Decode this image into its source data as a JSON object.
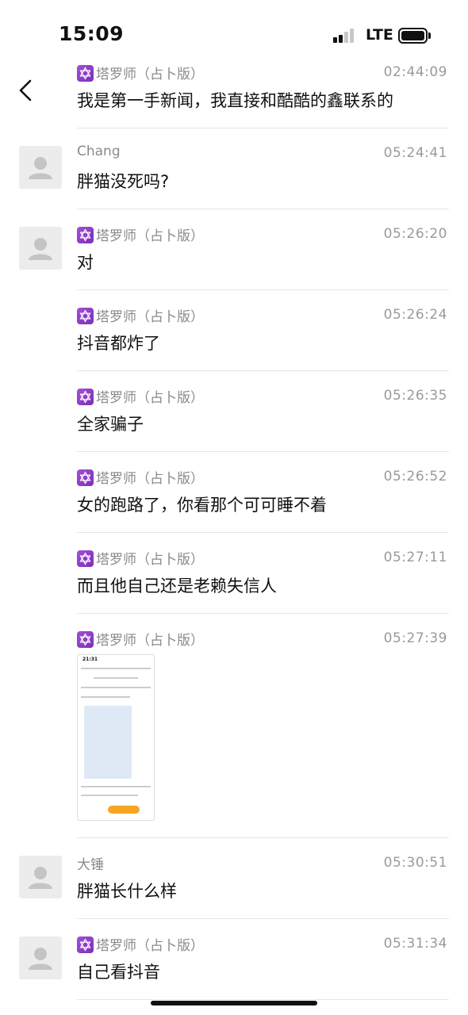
{
  "status_bar": {
    "time": "15:09",
    "network": "LTE"
  },
  "messages": [
    {
      "sender": "塔罗师（占卜版）",
      "time": "02:44:09",
      "text": "我是第一手新闻，我直接和酷酷的鑫联系的"
    },
    {
      "sender": "Chang",
      "time": "05:24:41",
      "text": "胖猫没死吗?"
    },
    {
      "sender": "塔罗师（占卜版）",
      "time": "05:26:20",
      "text": "对"
    },
    {
      "sender": "塔罗师（占卜版）",
      "time": "05:26:24",
      "text": "抖音都炸了"
    },
    {
      "sender": "塔罗师（占卜版）",
      "time": "05:26:35",
      "text": "全家骗子"
    },
    {
      "sender": "塔罗师（占卜版）",
      "time": "05:26:52",
      "text": "女的跑路了，你看那个可可睡不着"
    },
    {
      "sender": "塔罗师（占卜版）",
      "time": "05:27:11",
      "text": "而且他自己还是老赖失信人"
    },
    {
      "sender": "塔罗师（占卜版）",
      "time": "05:27:39",
      "text": ""
    },
    {
      "sender": "大锤",
      "time": "05:30:51",
      "text": "胖猫长什么样"
    },
    {
      "sender": "塔罗师（占卜版）",
      "time": "05:31:34",
      "text": "自己看抖音"
    }
  ],
  "image_thumbnail": {
    "time": "21:31"
  },
  "icons": {
    "back": "chevron-left-icon",
    "avatar": "default-avatar-icon",
    "tarot": "hexagram-icon"
  }
}
